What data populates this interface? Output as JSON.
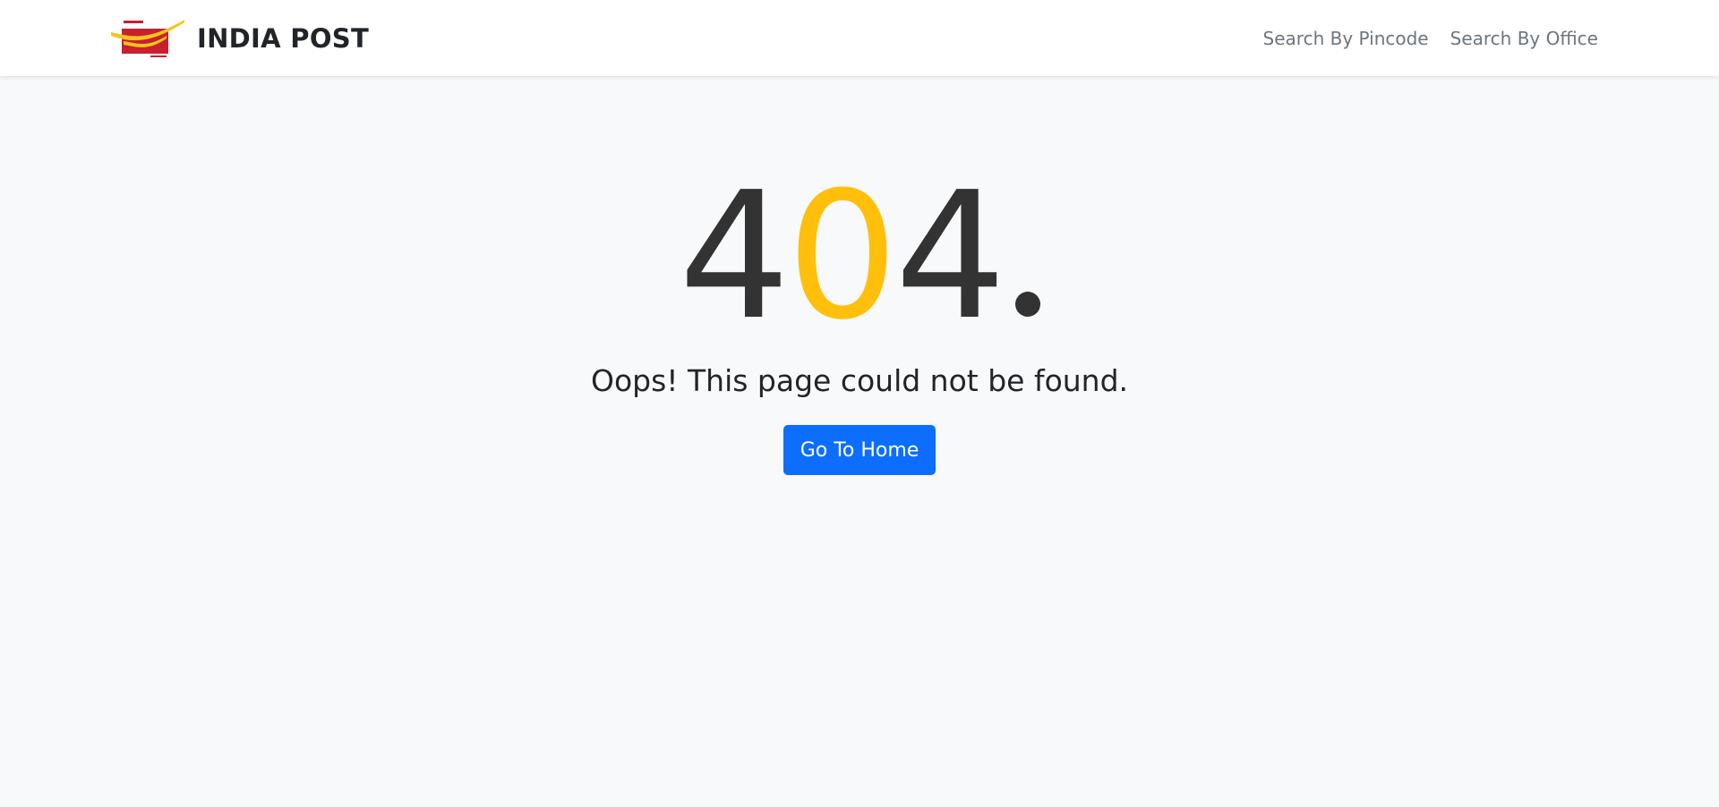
{
  "navbar": {
    "logo_icon": "india-post-logo",
    "brand": "INDIA POST",
    "links": [
      {
        "label": "Search By Pincode"
      },
      {
        "label": "Search By Office"
      }
    ]
  },
  "error": {
    "code_first": "4",
    "code_middle": "0",
    "code_last": "4",
    "message": "Oops! This page could not be found.",
    "button_label": "Go To Home"
  },
  "colors": {
    "accent": "#ffbf0b",
    "button": "#0d6efd",
    "text_dark": "#333333",
    "background": "#f8f9fa",
    "logo_red": "#c8202f",
    "logo_yellow": "#f6c51b"
  }
}
